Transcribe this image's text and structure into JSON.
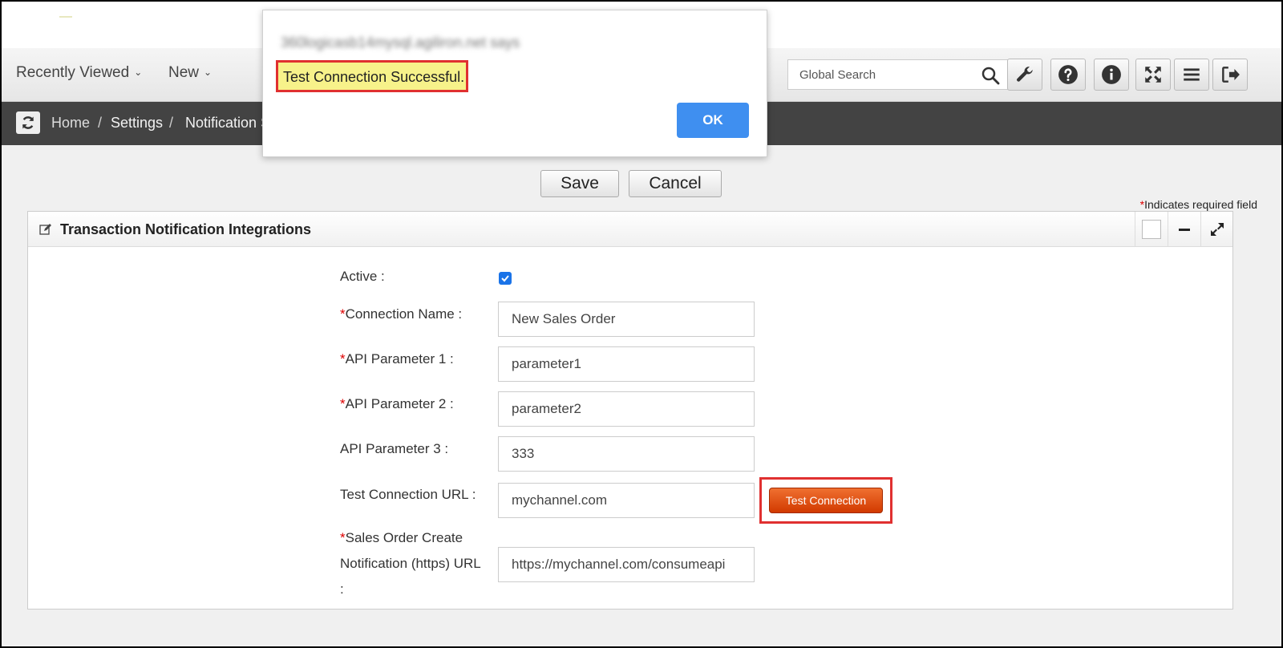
{
  "nav": {
    "recently_viewed": "Recently Viewed",
    "new": "New",
    "search_placeholder": "Global Search"
  },
  "breadcrumb": {
    "home": "Home",
    "settings": "Settings",
    "current": "Notification S"
  },
  "actions": {
    "save": "Save",
    "cancel": "Cancel"
  },
  "required_note": {
    "star": "*",
    "text": "Indicates required field"
  },
  "panel": {
    "title": "Transaction Notification Integrations"
  },
  "form": {
    "active_label": "Active :",
    "active_checked": true,
    "connection_name": {
      "required": "*",
      "label": "Connection Name :",
      "value": "New Sales Order"
    },
    "api_param_1": {
      "required": "*",
      "label": "API Parameter 1 :",
      "value": "parameter1"
    },
    "api_param_2": {
      "required": "*",
      "label": "API Parameter 2 :",
      "value": "parameter2"
    },
    "api_param_3": {
      "label": "API Parameter 3 :",
      "value": "333"
    },
    "test_url": {
      "label": "Test Connection URL :",
      "value": "mychannel.com"
    },
    "test_button": "Test Connection",
    "sales_order_url": {
      "required": "*",
      "label_line1": "Sales Order Create",
      "label_line2": "Notification (https) URL",
      "label_line3": ":",
      "value": "https://mychannel.com/consumeapi"
    }
  },
  "dialog": {
    "origin": "360logicasb14mysql.agiliron.net says",
    "message": "Test Connection Successful.",
    "ok": "OK"
  },
  "colors": {
    "accent_blue": "#3f8ff0",
    "test_button": "#e0531a",
    "highlight": "#e03030",
    "crumb_bar": "#434343"
  }
}
